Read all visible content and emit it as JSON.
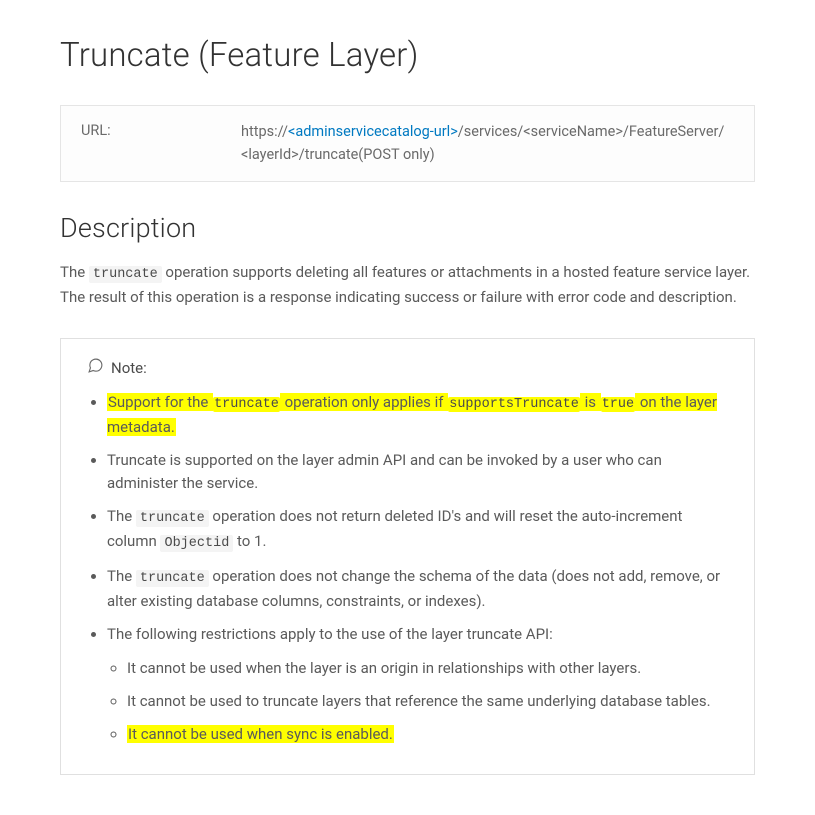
{
  "title": "Truncate (Feature Layer)",
  "url": {
    "label": "URL:",
    "prefix": "https://",
    "link": "<adminservicecatalog-url>",
    "suffix": "/services/<serviceName>/FeatureServer/ <layerId>/truncate(POST only)"
  },
  "description": {
    "heading": "Description",
    "p1a": "The ",
    "p1code": "truncate",
    "p1b": " operation supports deleting all features or attachments in a hosted feature service layer. The result of this operation is a response indicating success or failure with error code and description."
  },
  "note": {
    "label": "Note:",
    "b1": {
      "t1": "Support for the ",
      "code1": "truncate",
      "t2": " operation only applies if ",
      "code2": "supportsTruncate",
      "t3": " is ",
      "code3": "true",
      "t4": " on the layer metadata."
    },
    "b2": "Truncate is supported on the layer admin API and can be invoked by a user who can administer the service.",
    "b3": {
      "t1": "The ",
      "code1": "truncate",
      "t2": " operation does not return deleted ID's and will reset the auto-increment column ",
      "code2": "Objectid",
      "t3": " to 1."
    },
    "b4": {
      "t1": "The ",
      "code1": "truncate",
      "t2": " operation does not change the schema of the data (does not add, remove, or alter existing database columns, constraints, or indexes)."
    },
    "b5": "The following restrictions apply to the use of the layer truncate API:",
    "b5a": "It cannot be used when the layer is an origin in relationships with other layers.",
    "b5b": "It cannot be used to truncate layers that reference the same underlying database tables.",
    "b5c": "It cannot be used when sync is enabled."
  }
}
